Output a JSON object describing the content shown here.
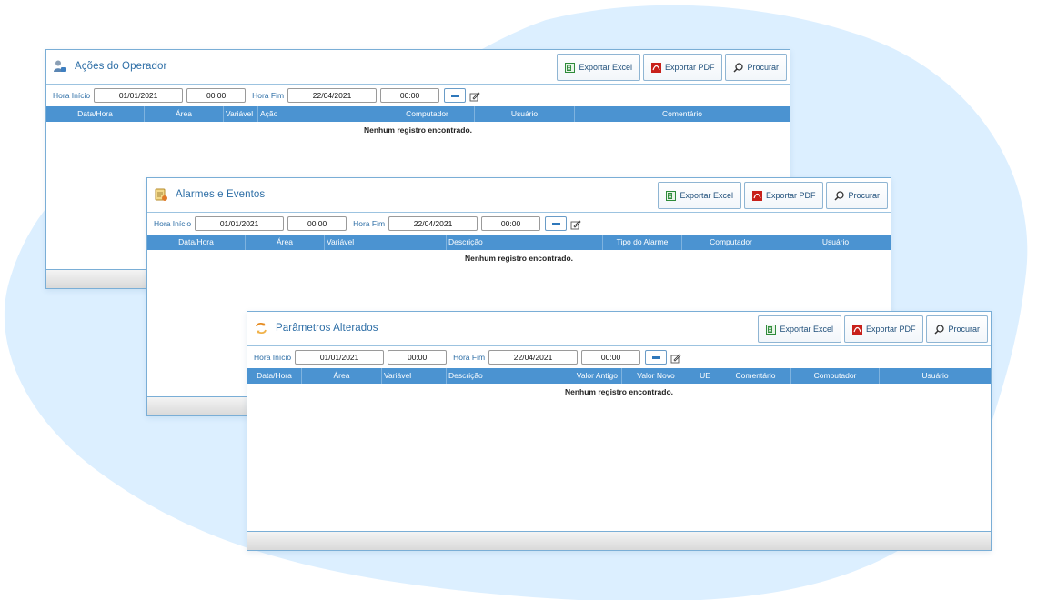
{
  "panels": [
    {
      "title": "Ações do Operador",
      "icon": "operator-icon",
      "buttons": {
        "excel": "Exportar Excel",
        "pdf": "Exportar PDF",
        "search": "Procurar"
      },
      "filters": {
        "start_label": "Hora Início",
        "start_date": "01/01/2021",
        "start_time": "00:00",
        "end_label": "Hora Fim",
        "end_date": "22/04/2021",
        "end_time": "00:00"
      },
      "columns": [
        "Data/Hora",
        "Área",
        "Variável",
        "Ação",
        "Computador",
        "Usuário",
        "Comentário"
      ],
      "empty_message": "Nenhum registro encontrado."
    },
    {
      "title": "Alarmes e Eventos",
      "icon": "alarm-notepad-icon",
      "buttons": {
        "excel": "Exportar Excel",
        "pdf": "Exportar PDF",
        "search": "Procurar"
      },
      "filters": {
        "start_label": "Hora Início",
        "start_date": "01/01/2021",
        "start_time": "00:00",
        "end_label": "Hora Fim",
        "end_date": "22/04/2021",
        "end_time": "00:00"
      },
      "columns": [
        "Data/Hora",
        "Área",
        "Variável",
        "Descrição",
        "Tipo do Alarme",
        "Computador",
        "Usuário"
      ],
      "empty_message": "Nenhum registro encontrado."
    },
    {
      "title": "Parâmetros Alterados",
      "icon": "exchange-arrows-icon",
      "buttons": {
        "excel": "Exportar Excel",
        "pdf": "Exportar PDF",
        "search": "Procurar"
      },
      "filters": {
        "start_label": "Hora Início",
        "start_date": "01/01/2021",
        "start_time": "00:00",
        "end_label": "Hora Fim",
        "end_date": "22/04/2021",
        "end_time": "00:00"
      },
      "columns": [
        "Data/Hora",
        "Área",
        "Variável",
        "Descrição",
        "Valor Antigo",
        "Valor Novo",
        "UE",
        "Comentário",
        "Computador",
        "Usuário"
      ],
      "empty_message": "Nenhum registro encontrado."
    }
  ],
  "colors": {
    "accent": "#2d6ea6",
    "table_header": "#4b93d1",
    "background_blob": "#dcefff",
    "panel_border": "#7aaed6"
  }
}
